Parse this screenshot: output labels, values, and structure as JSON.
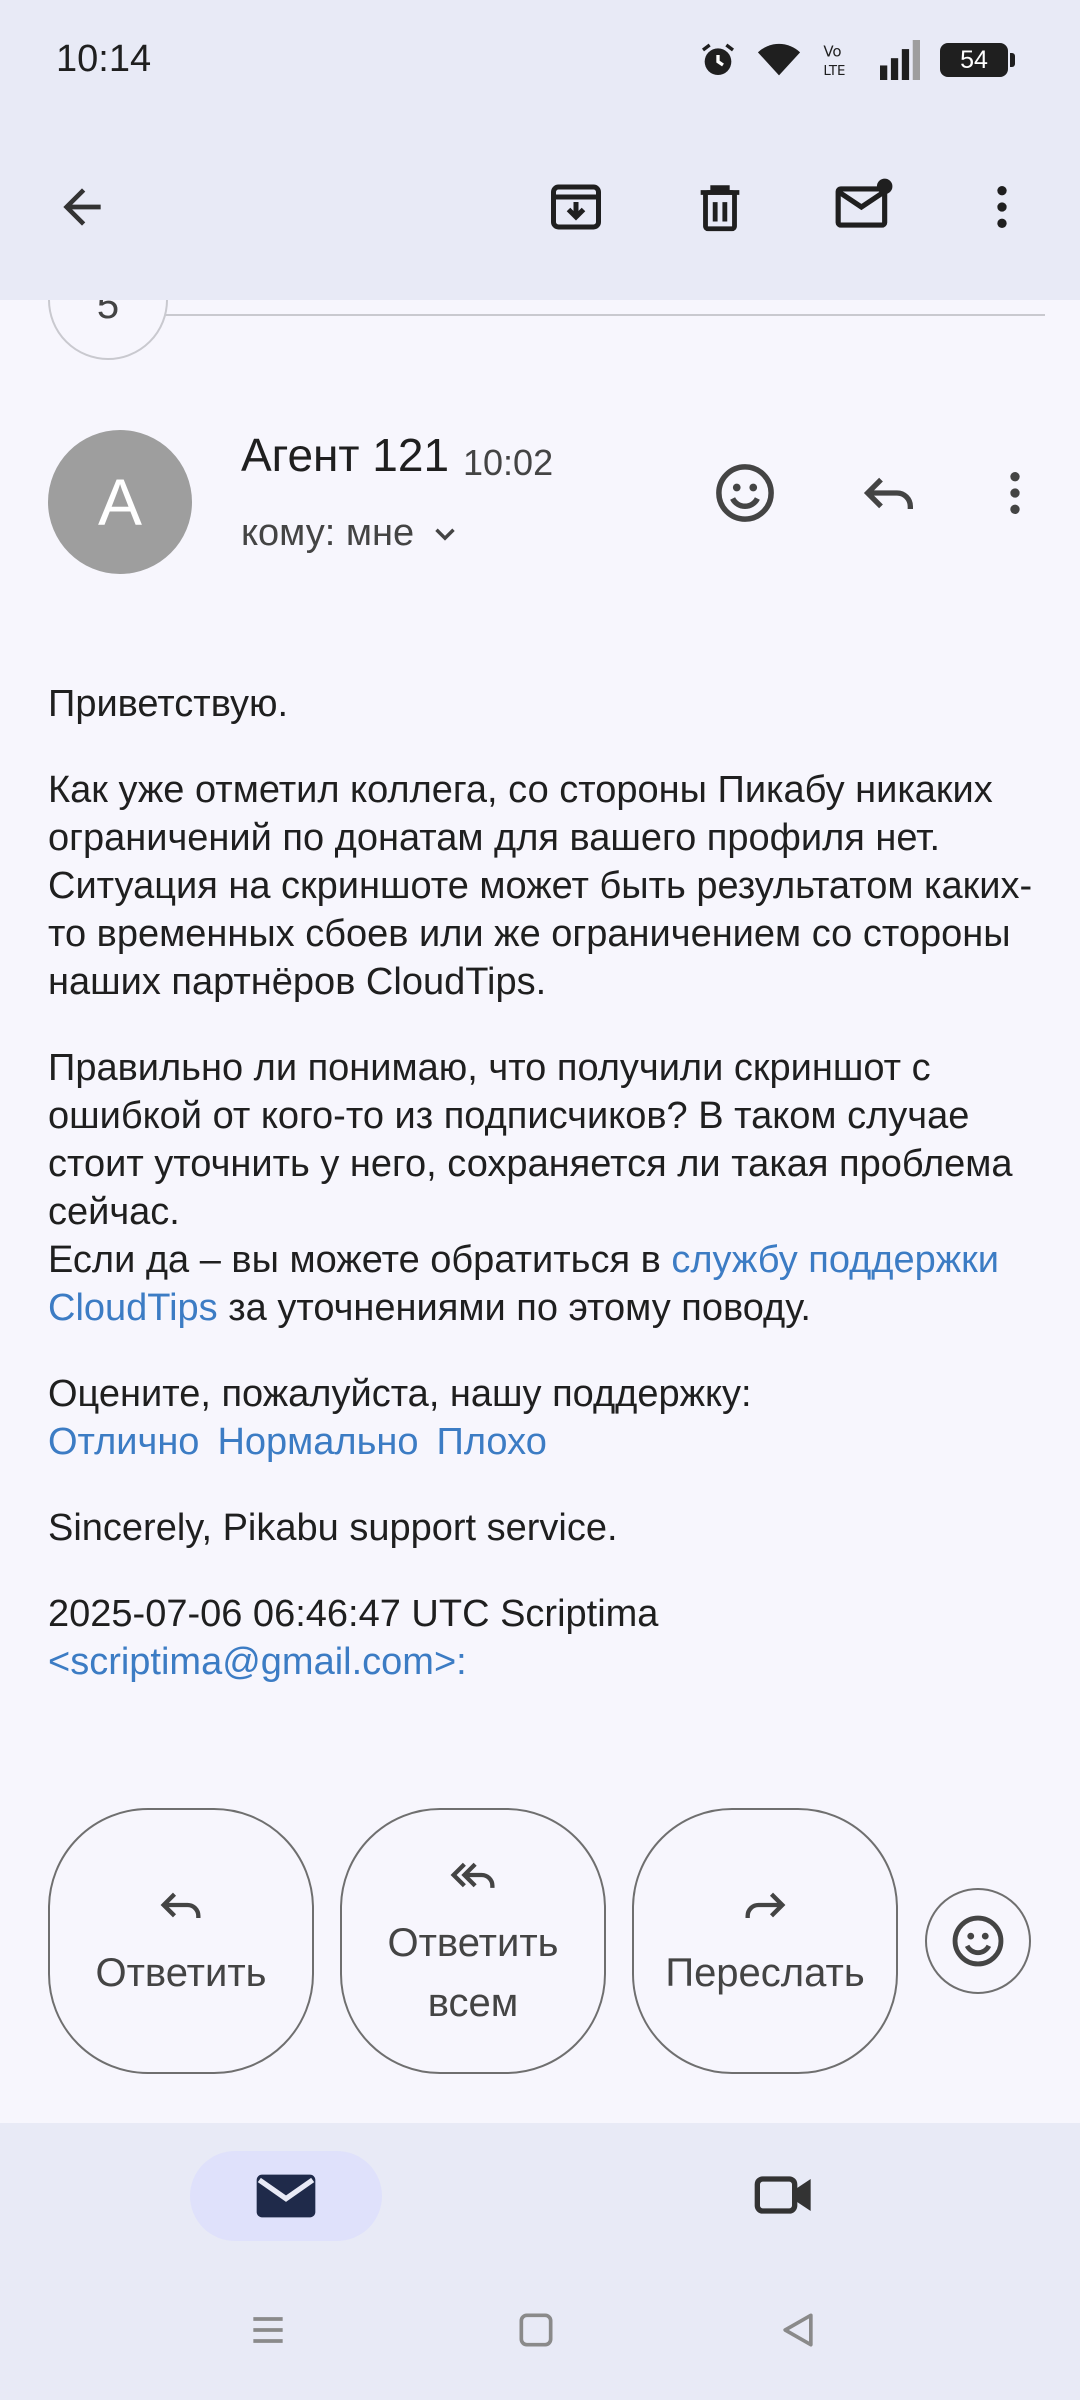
{
  "status_bar": {
    "time": "10:14",
    "battery": "54",
    "icons": [
      "alarm-icon",
      "wifi-icon",
      "volte-icon",
      "signal-icon",
      "battery-icon"
    ]
  },
  "toolbar": {
    "back_icon": "arrow-back-icon",
    "actions": [
      "archive-icon",
      "delete-icon",
      "mark-unread-icon",
      "more-vert-icon"
    ]
  },
  "thread": {
    "collapsed_count": "5"
  },
  "message": {
    "avatar_letter": "A",
    "sender": "Агент 121",
    "time": "10:02",
    "recipient": "кому: мне",
    "body": {
      "greeting": "Приветствую.",
      "para1_line1": "Как уже отметил коллега, со стороны Пикабу никаких ограничений по донатам для вашего профиля нет.",
      "para1_line2": "Ситуация на скриншоте может быть результатом каких-то временных сбоев или же ограничением со стороны наших партнёров CloudTips.",
      "para2_line1": "Правильно ли понимаю, что получили скриншот с ошибкой от кого-то из подписчиков? В таком случае стоит уточнить у него, сохраняется ли такая проблема сейчас.",
      "para2_line2_prefix": "Если да – вы можете обратиться в ",
      "para2_link": "службу поддержки CloudTips",
      "para2_line2_suffix": " за уточнениями по этому поводу.",
      "rate_prompt": "Оцените, пожалуйста, нашу поддержку:",
      "rate_excellent": "Отлично",
      "rate_normal": "Нормально",
      "rate_bad": "Плохо",
      "signature": "Sincerely, Pikabu support service.",
      "quote_header": "2025-07-06 06:46:47 UTC Scriptima",
      "quote_email_partial": "<scriptima@gmail.com>:"
    }
  },
  "actions": {
    "reply": "Ответить",
    "reply_all": "Ответить всем",
    "forward": "Переслать"
  },
  "colors": {
    "link": "#3c7cc4",
    "excellent": "#1f7a1f",
    "normal": "#8a8a8a",
    "bad": "#cc1111"
  }
}
